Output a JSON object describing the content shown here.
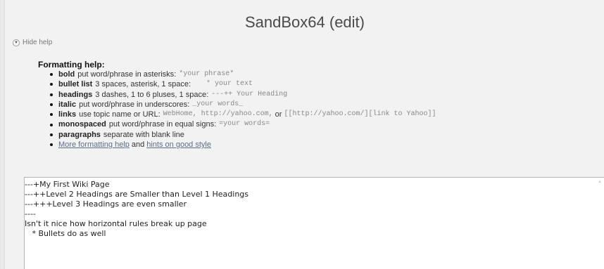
{
  "title": "SandBox64 (edit)",
  "hide_help": "Hide help",
  "help": {
    "heading": "Formatting help:",
    "items": [
      {
        "term": "bold",
        "desc": "put word/phrase in asterisks:",
        "code": "*your phrase*"
      },
      {
        "term": "bullet list",
        "desc": "3 spaces, asterisk, 1 space:",
        "code": "   * your text"
      },
      {
        "term": "headings",
        "desc": "3 dashes, 1 to 6 pluses, 1 space:",
        "code": "---++ Your Heading"
      },
      {
        "term": "italic",
        "desc": "put word/phrase in underscores:",
        "code": "_your words_"
      },
      {
        "term": "links",
        "desc": "use topic name or URL:",
        "code1": "WebHome, http://yahoo.com,",
        "or_text": "or",
        "code2": "[[http://yahoo.com/][link to Yahoo]]"
      },
      {
        "term": "monospaced",
        "desc": "put word/phrase in equal signs:",
        "code": "=your words="
      },
      {
        "term": "paragraphs",
        "desc": "separate with blank line",
        "code": ""
      }
    ],
    "more_link": "More formatting help",
    "and_text": "and",
    "hints_link": "hints on good style"
  },
  "editor": {
    "content": "---+My First Wiki Page\n---++Level 2 Headings are Smaller than Level 1 Headings\n---+++Level 3 Headings are even smaller\n----\nIsn't it nice how horizontal rules break up page\n   * Bullets do as well"
  }
}
